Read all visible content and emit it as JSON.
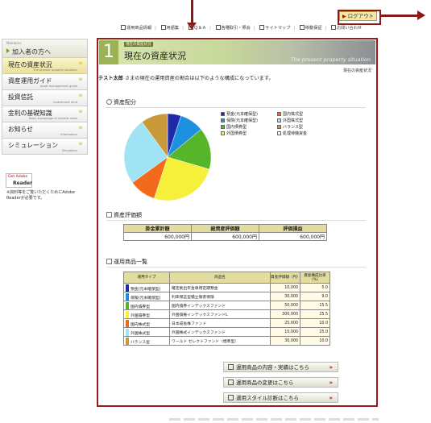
{
  "header": {
    "logout_label": "ログアウト",
    "nav": [
      "運用商品情報",
      "用語集",
      "Ｑ＆Ａ",
      "各種取引・照会",
      "サイトマップ",
      "移動保証",
      "お問い合わせ"
    ]
  },
  "sidebar": {
    "member_small": "Members",
    "member_title": "加入者の方へ",
    "items": [
      {
        "label": "現在の資産状況",
        "sub": "The present property situation",
        "active": true
      },
      {
        "label": "資産運用ガイド",
        "sub": "Asset management guide",
        "active": false
      },
      {
        "label": "投資信託",
        "sub": "Investment fund",
        "active": false
      },
      {
        "label": "金利の基礎知識",
        "sub": "Basic knowledge of interest rates",
        "active": false
      },
      {
        "label": "お知らせ",
        "sub": "Information",
        "active": false
      },
      {
        "label": "シミュレーション",
        "sub": "Simulation",
        "active": false
      }
    ],
    "adobe_get": "Get Adobe",
    "adobe_reader": "Reader",
    "adobe_note": "※資料等をご覧いただくためにAdobe Readerが必要です。"
  },
  "main": {
    "banner_num": "1",
    "banner_small": "現在の資産状況",
    "banner_title": "現在の資産状況",
    "banner_en": "The present property situation",
    "breadcrumb": "現在の資産状況",
    "intro_name": "テスト太郎",
    "intro_rest": "さまの現在の運用資産の割合は以下のような構成になっています。",
    "section1": "資産配分",
    "section2": "資産評価額",
    "section3": "運用商品一覧",
    "summary": {
      "headers": [
        "掛金累計額",
        "総資産評価額",
        "評価損益"
      ],
      "values": [
        "600,000円",
        "600,000円",
        "600,000円"
      ]
    },
    "funds_headers": [
      "運用タイプ",
      "商品名",
      "資産評価額（円）",
      "資産構成比率（%）"
    ],
    "funds": [
      {
        "type": "預金(元本確保型)",
        "name": "確定拠出年金専用定期預金",
        "value": "10,000",
        "ratio": "5.0",
        "color": "#1f2aa8"
      },
      {
        "type": "保険(元本確保型)",
        "name": "利率保証型積立傷害保険",
        "value": "30,000",
        "ratio": "9.0",
        "color": "#1e90e0"
      },
      {
        "type": "国内債券型",
        "name": "国内債券インデックスファンド",
        "value": "50,000",
        "ratio": "15.5",
        "color": "#57b52a"
      },
      {
        "type": "外国債券型",
        "name": "外国債権インデックスファンドL",
        "value": "300,000",
        "ratio": "25.5",
        "color": "#f7f03a"
      },
      {
        "type": "国内株式型",
        "name": "日本成長株ファンド",
        "value": "25,000",
        "ratio": "10.0",
        "color": "#f26b1d"
      },
      {
        "type": "外国株式型",
        "name": "外国株式インデックスファンド",
        "value": "10,000",
        "ratio": "25.0",
        "color": "#9fe3f5"
      },
      {
        "type": "バランス型",
        "name": "ワールド セレクトファンド（標準型）",
        "value": "30,000",
        "ratio": "10.0",
        "color": "#c99a3a"
      }
    ],
    "buttons": [
      "運用商品の内容・実績はこちら",
      "運用商品の変更はこちら",
      "運用スタイル診断はこちら"
    ]
  },
  "chart_data": {
    "type": "pie",
    "title": "",
    "series": [
      {
        "values": [
          5.0,
          9.0,
          15.5,
          25.5,
          10.0,
          25.0,
          10.0
        ]
      }
    ],
    "labels": [
      "預金(元本確保型)",
      "保険(元本確保型)",
      "国内債券型",
      "外国債券型",
      "国内株式型",
      "外国株式型",
      "バランス型"
    ],
    "legend_labels": [
      "預金(元本確保型)",
      "国内株式型",
      "保険(元本確保型)",
      "外国株式型",
      "国内債券型",
      "バランス型",
      "外国債券型",
      "処理待機資金"
    ],
    "legend_colors": [
      "#1f2aa8",
      "#f26b1d",
      "#1e90e0",
      "#9fe3f5",
      "#57b52a",
      "#c99a3a",
      "#f7f03a",
      "#ffffff"
    ],
    "colors": [
      "#1f2aa8",
      "#1e90e0",
      "#57b52a",
      "#f7f03a",
      "#f26b1d",
      "#9fe3f5",
      "#c99a3a"
    ],
    "legend_position": "right"
  }
}
